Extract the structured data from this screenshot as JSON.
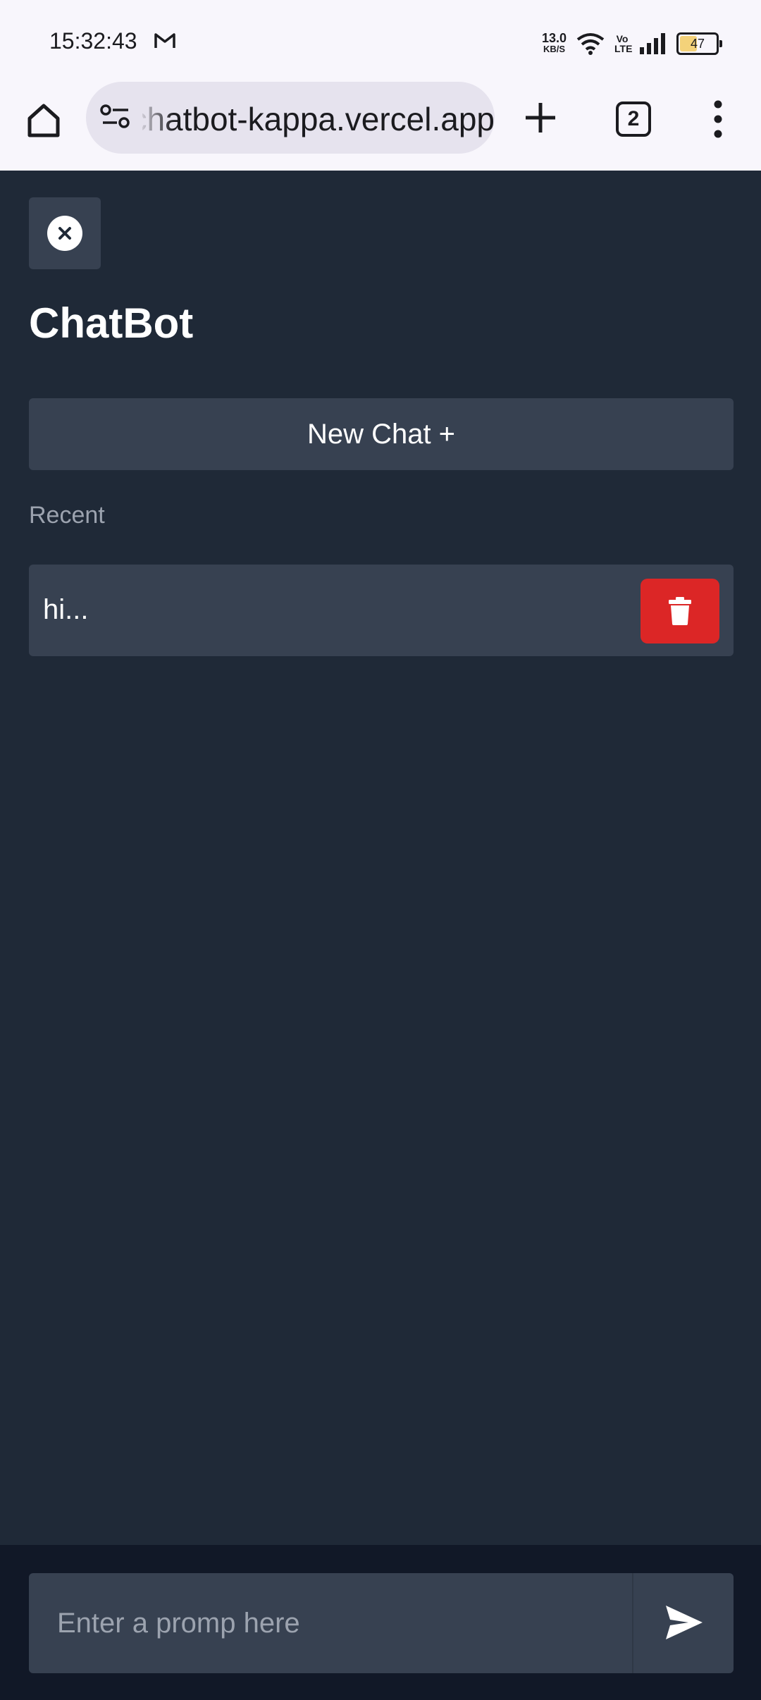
{
  "status_bar": {
    "time": "15:32:43",
    "net_speed_value": "13.0",
    "net_speed_unit": "KB/S",
    "volte": "Vo LTE",
    "battery": "47"
  },
  "browser": {
    "url": "chatbot-kappa.vercel.app",
    "tab_count": "2"
  },
  "app": {
    "title": "ChatBot",
    "new_chat_label": "New Chat +",
    "recent_label": "Recent",
    "chats": [
      {
        "label": "hi..."
      }
    ]
  },
  "composer": {
    "placeholder": "Enter a promp here"
  },
  "colors": {
    "background": "#1f2937",
    "surface": "#374151",
    "bottom_bar": "#111827",
    "delete": "#dc2626",
    "muted_text": "#9ca3af"
  }
}
